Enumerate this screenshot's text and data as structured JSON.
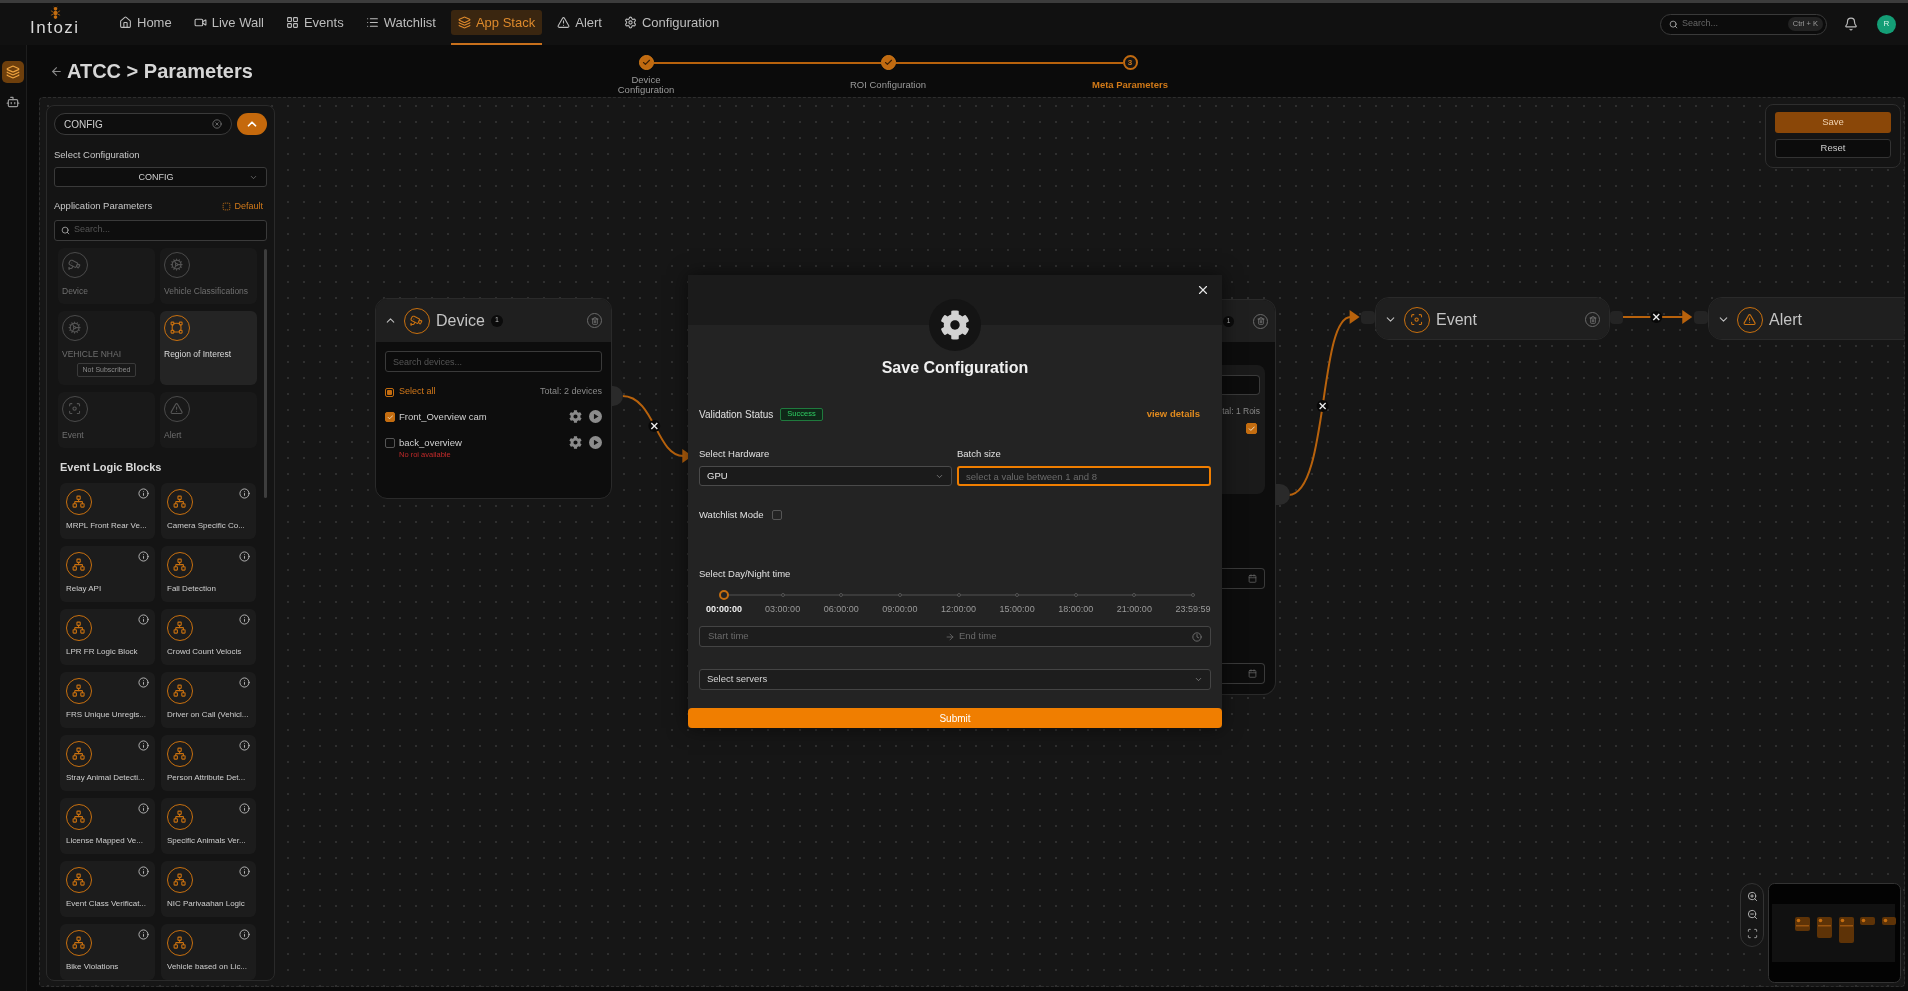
{
  "nav": {
    "logo": "Intozi",
    "items": [
      {
        "label": "Home",
        "kind": "home",
        "selected": false
      },
      {
        "label": "Live Wall",
        "kind": "live_wall",
        "selected": false
      },
      {
        "label": "Events",
        "kind": "events",
        "selected": false
      },
      {
        "label": "Watchlist",
        "kind": "watchlist",
        "selected": false
      },
      {
        "label": "App Stack",
        "kind": "app_stack",
        "selected": true
      },
      {
        "label": "Alert",
        "kind": "alert",
        "selected": false
      },
      {
        "label": "Configuration",
        "kind": "configuration",
        "selected": false
      }
    ],
    "search": {
      "placeholder": "Search...",
      "shortcut": "Ctrl + K"
    },
    "avatar": "R"
  },
  "rail": {
    "items": [
      {
        "kind": "layers",
        "selected": true
      },
      {
        "kind": "robot",
        "selected": false
      }
    ]
  },
  "header": {
    "title": "ATCC > Parameters"
  },
  "stepper": [
    {
      "label": "Device Configuration",
      "completed": true,
      "selected": false
    },
    {
      "label": "ROI Configuration",
      "completed": true,
      "selected": false
    },
    {
      "label": "Meta Parameters",
      "number": "3",
      "completed": false,
      "selected": true
    }
  ],
  "sidebar": {
    "config_search": {
      "value": "CONFIG"
    },
    "select_configuration": {
      "label": "Select Configuration",
      "value": "CONFIG"
    },
    "application_parameters": {
      "title": "Application Parameters",
      "default_button": "Default",
      "search": {
        "placeholder": "Search..."
      },
      "items": [
        {
          "label": "Device",
          "kind": "device",
          "disabled": true
        },
        {
          "label": "Vehicle Classifications",
          "kind": "classification",
          "disabled": true
        },
        {
          "label": "VEHICLE NHAI",
          "kind": "classification",
          "disabled": true,
          "badge": "Not Subscribed"
        },
        {
          "label": "Region of Interest",
          "kind": "roi",
          "disabled": false
        },
        {
          "label": "Event",
          "kind": "event",
          "disabled": true
        },
        {
          "label": "Alert",
          "kind": "alert",
          "disabled": true
        }
      ]
    },
    "event_logic_blocks": {
      "title": "Event Logic Blocks",
      "items": [
        "MRPL Front Rear Ve...",
        "Camera Specific Co...",
        "Relay API",
        "Fall Detection",
        "LPR FR Logic Block",
        "Crowd Count Velocis",
        "FRS Unique Unregis...",
        "Driver on Call (Vehicl...",
        "Stray Animal Detecti...",
        "Person Attribute Det...",
        "License Mapped Ve...",
        "Specific Animals Ver...",
        "Event Class Verificat...",
        "NIC Parivaahan Logic",
        "Bike Violations",
        "Vehicle based on Lic..."
      ]
    }
  },
  "canvas": {
    "nodes": [
      {
        "kind": "device",
        "title": "Device",
        "count": "1",
        "expanded": true,
        "search": {
          "placeholder": "Search devices..."
        },
        "select_all": {
          "label": "Select all",
          "indeterminate": true
        },
        "total": "Total: 2 devices",
        "devices": [
          {
            "name": "Front_Overview cam",
            "checked": true
          },
          {
            "name": "back_overview",
            "checked": false,
            "warning": "No roi available"
          }
        ]
      },
      {
        "kind": "roi",
        "count": "1",
        "total": "tal: 1 Rois",
        "checked": true
      },
      {
        "kind": "event",
        "title": "Event",
        "expanded": false
      },
      {
        "kind": "alert",
        "title": "Alert",
        "expanded": false
      }
    ],
    "actions": {
      "save": "Save",
      "reset": "Reset"
    }
  },
  "modal": {
    "title": "Save Configuration",
    "validation": {
      "label": "Validation Status",
      "status": {
        "label": "Success",
        "kind": "success"
      },
      "link": "view details"
    },
    "hardware": {
      "label": "Select Hardware",
      "value": "GPU"
    },
    "batch_size": {
      "label": "Batch size",
      "placeholder": "select a value between 1 and 8",
      "focused": true
    },
    "watchlist_mode": {
      "label": "Watchlist Mode",
      "checked": false
    },
    "day_night": {
      "label": "Select Day/Night time",
      "level": 0,
      "marks": [
        "00:00:00",
        "03:00:00",
        "06:00:00",
        "09:00:00",
        "12:00:00",
        "15:00:00",
        "18:00:00",
        "21:00:00",
        "23:59:59"
      ]
    },
    "time_range": {
      "start_placeholder": "Start time",
      "end_placeholder": "End time"
    },
    "servers": {
      "placeholder": "Select servers"
    },
    "submit": "Submit"
  }
}
